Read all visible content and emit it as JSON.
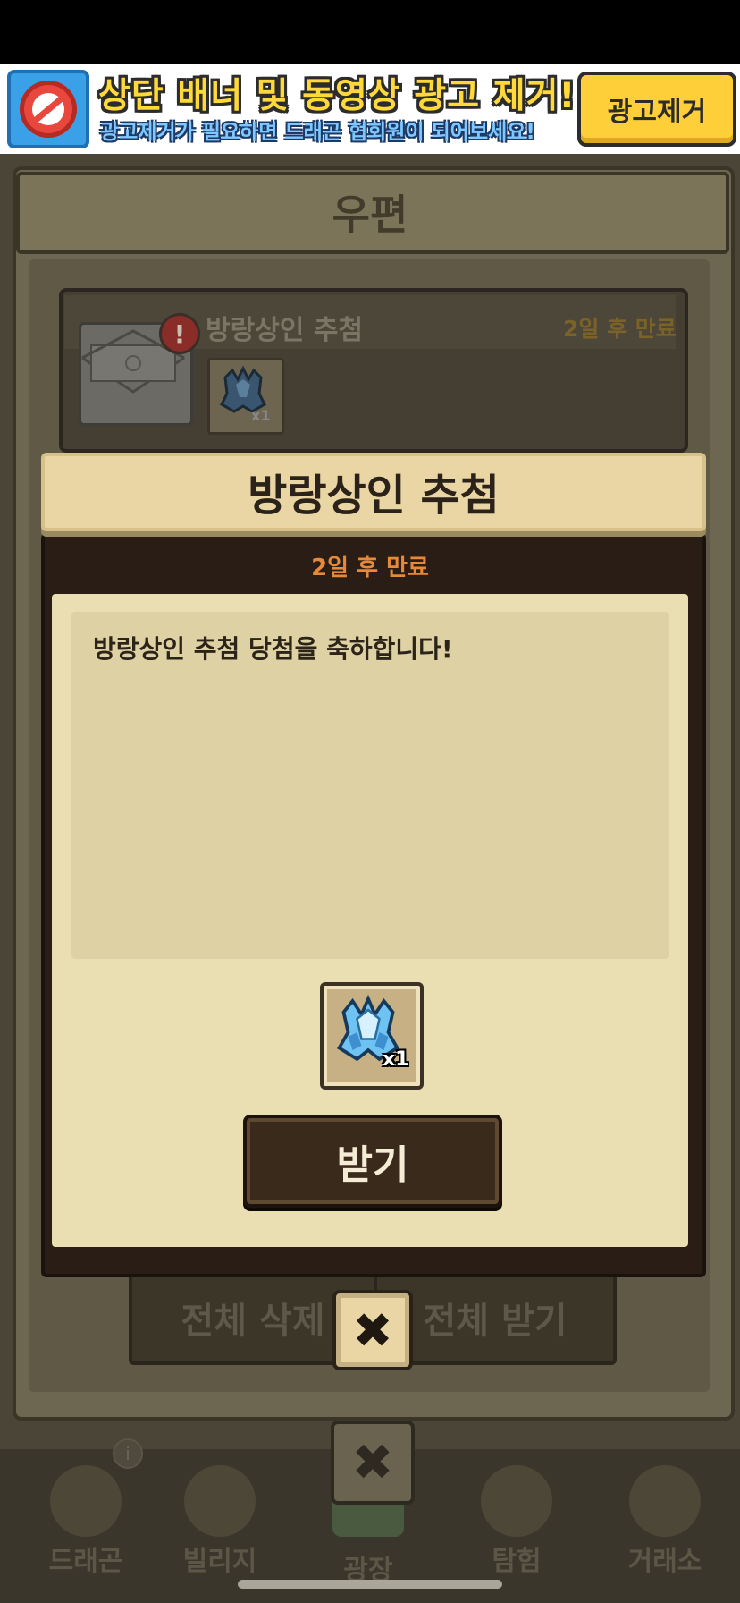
{
  "ad": {
    "title": "상단 배너 및 동영상 광고 제거!",
    "subtitle": "광고제거가 필요하면 드래곤 협회원이 되어보세요!",
    "remove_button": "광고제거"
  },
  "background": {
    "mail_title": "우편",
    "mail_item": {
      "alert": "!",
      "title": "방랑상인 추첨",
      "expire": "2일 후 만료",
      "item_count": "x1"
    },
    "delete_all_label": "전체 삭제",
    "receive_all_label": "전체 받기",
    "close_label": "✖",
    "nav": {
      "badge": "i",
      "items": [
        {
          "label": "드래곤"
        },
        {
          "label": "빌리지"
        },
        {
          "label": "광장"
        },
        {
          "label": "탐험"
        },
        {
          "label": "거래소"
        }
      ]
    }
  },
  "dialog": {
    "title": "방랑상인 추첨",
    "expire": "2일 후 만료",
    "message": "방랑상인 추첨 당첨을 축하합니다!",
    "reward_count": "x1",
    "receive_label": "받기",
    "close_label": "✖"
  }
}
